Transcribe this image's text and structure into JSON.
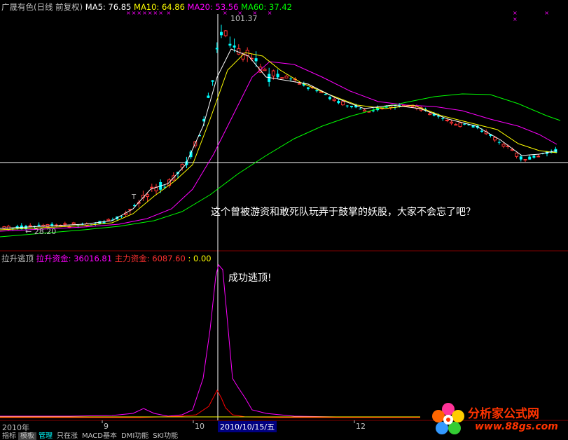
{
  "header": {
    "stock": "广晟有色(日线 前复权)",
    "ma5_label": "MA5: 76.85",
    "ma10_label": "MA10: 64.86",
    "ma20_label": "MA20: 53.56",
    "ma60_label": "MA60: 37.42"
  },
  "price_panel": {
    "high_label": "101.37",
    "low_label": "← 28.20",
    "annotation": "这个曾被游资和敢死队玩弄于鼓掌的妖股，大家不会忘了吧？",
    "t_label": "T"
  },
  "indicator_panel": {
    "name": "拉升逃顶",
    "line1_label": "拉升资金: 36016.81",
    "line2_label": "主力资金: 6087.60",
    "line3_label": ": 0.00",
    "annotation": "成功逃顶!"
  },
  "date_axis": {
    "label_year": "2010年",
    "label_9": "9",
    "label_10": "10",
    "label_cursor": "2010/10/15/五",
    "label_12": "12"
  },
  "bottom_tabs": [
    "指标",
    "模板",
    "管理",
    "只在涨",
    "MACD基本",
    "DMI功能",
    "SKI功能"
  ],
  "logo": {
    "name": "分析家公式网",
    "url": "www.88gs.com"
  },
  "colors": {
    "background": "#000000",
    "up": "#ff3333",
    "down": "#00ffff",
    "ma5": "#ffffff",
    "ma10": "#ffff00",
    "ma20": "#ff00ff",
    "ma60": "#00ff00",
    "divider": "#800000",
    "crosshair": "#ffffff",
    "line_pink": "#ff00ff",
    "line_red": "#ff0000",
    "line_yellow": "#ffff00"
  },
  "chart_data": {
    "type": "candlestick",
    "y_axis_range": [
      20,
      105
    ],
    "high_point": 101.37,
    "low_point": 28.2,
    "crosshair_date": "2010/10/15"
  }
}
